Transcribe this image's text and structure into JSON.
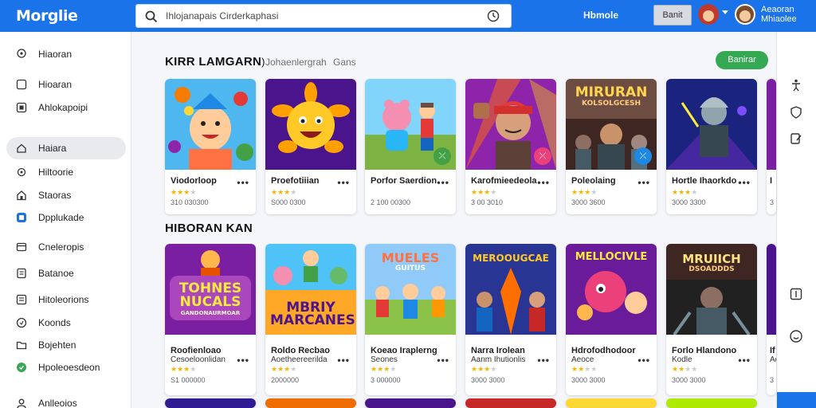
{
  "app": {
    "logo": "Morglie"
  },
  "search": {
    "text": "Ihlojanapais  Cirderkaphasi"
  },
  "header": {
    "link": "Hbmole",
    "button": "Banit",
    "user_line1": "Aeaoran",
    "user_line2": "Mhiaolee"
  },
  "sidebar": {
    "items": [
      {
        "label": "Hiaoran",
        "icon": "location-pin-icon"
      },
      {
        "label": "Hioaran",
        "icon": "square-icon"
      },
      {
        "label": "Ahlokapoipi",
        "icon": "app-square-icon"
      },
      {
        "label": "Haiara",
        "icon": "home-icon",
        "active": true
      },
      {
        "label": "Hiltoorie",
        "icon": "gear-icon"
      },
      {
        "label": "Staoras",
        "icon": "house-icon"
      },
      {
        "label": "Dpplukade",
        "icon": "blue-app-icon"
      },
      {
        "label": "Cneleropis",
        "icon": "card-icon"
      },
      {
        "label": "Batanoe",
        "icon": "document-icon"
      },
      {
        "label": "Hitoleorions",
        "icon": "list-icon"
      },
      {
        "label": "Koonds",
        "icon": "circle-icon"
      },
      {
        "label": "Bojehten",
        "icon": "folder-icon"
      },
      {
        "label": "Hpoleoesdeon",
        "icon": "green-circle-icon"
      },
      {
        "label": "Anlleoios",
        "icon": "user-icon"
      }
    ]
  },
  "section1": {
    "title": "KIRR LAMGARN",
    "title_suffix": ")",
    "links": [
      "Johaenlergrah",
      "Gans"
    ],
    "button": "Banirar",
    "cards": [
      {
        "title": "Viodorloop",
        "stars": 3,
        "meta": "310 030300"
      },
      {
        "title": "Proefotiiian",
        "stars": 3,
        "meta": "S000 0300"
      },
      {
        "title": "Porfor Saerdion",
        "stars": 0,
        "meta": "2 100 00300",
        "badge": "⤫"
      },
      {
        "title": "Karofmieedeola",
        "stars": 3,
        "meta": "3 00 3010",
        "badge": "⤫"
      },
      {
        "title": "Poleolaing",
        "stars": 3,
        "meta": "3000 3600",
        "badge": "⤫",
        "art_title": "MIRURAN",
        "art_sub": "KOLSOLGCESH"
      },
      {
        "title": "Hortle Ihaorkdo",
        "stars": 3,
        "meta": "3000 3300"
      },
      {
        "title": "I",
        "stars": 1,
        "meta": "3"
      }
    ]
  },
  "section2": {
    "title": "HIBORAN KAN",
    "cards": [
      {
        "title": "Roofienloao",
        "sub": "Cesoeloonlidan",
        "stars": 3,
        "meta": "S1 000000",
        "art_title": "TOHNES NUCALS",
        "art_sub": "GANDONAURMOAR"
      },
      {
        "title": "Roldo Recbao",
        "sub": "Aoetheereerilda",
        "stars": 3,
        "meta": "2000000",
        "art_title": "MBRIY MARCANES"
      },
      {
        "title": "Koeao Iraplerng",
        "sub": "Seones",
        "stars": 3,
        "meta": "3 000000",
        "art_title": "MUELES",
        "art_sub": "GUITUS"
      },
      {
        "title": "Narra Irolean",
        "sub": "Aanm Ihutionlis",
        "stars": 3,
        "meta": "3000 3000",
        "art_title": "MEROOUGCAE"
      },
      {
        "title": "Hdrofodhodoor",
        "sub": "Aeoce",
        "stars": 2,
        "meta": "3000 3000",
        "art_title": "MELLOCIVLE"
      },
      {
        "title": "Forlo Hlandono",
        "sub": "Kodle",
        "stars": 2,
        "meta": "3000 3000",
        "art_title": "MRUIICH",
        "art_sub": "DSOADDDS"
      },
      {
        "title": "If",
        "sub": "Ad",
        "stars": 1,
        "meta": "3"
      }
    ]
  },
  "colors": {
    "accent": "#1a73e8",
    "green": "#34a853",
    "star": "#f4b400"
  }
}
